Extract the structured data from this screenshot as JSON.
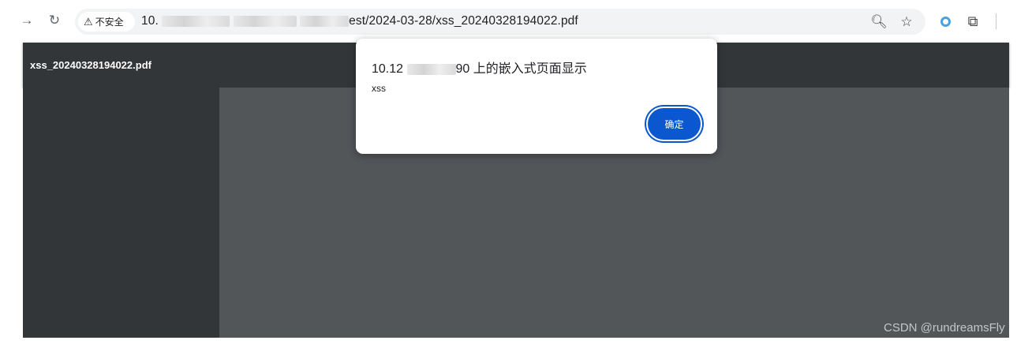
{
  "browser": {
    "security_label": "不安全",
    "url_prefix": "10.",
    "url_suffix": "est/2024-03-28/xss_20240328194022.pdf"
  },
  "icons": {
    "forward": "forward-arrow-icon",
    "reload": "reload-icon",
    "warning": "warning-triangle-icon",
    "zoom": "zoom-icon",
    "bookmark": "star-icon",
    "extension_ring": "extension-ring-icon",
    "extensions": "puzzle-icon"
  },
  "pdf_viewer": {
    "file_name": "xss_20240328194022.pdf"
  },
  "dialog": {
    "title_prefix": "10.12",
    "title_suffix": "90 上的嵌入式页面显示",
    "message": "xss",
    "ok_label": "确定"
  },
  "watermark": "CSDN @rundreamsFly",
  "colors": {
    "pdf_header": "#323639",
    "pdf_background": "#525659",
    "ok_button": "#0b57d0"
  }
}
